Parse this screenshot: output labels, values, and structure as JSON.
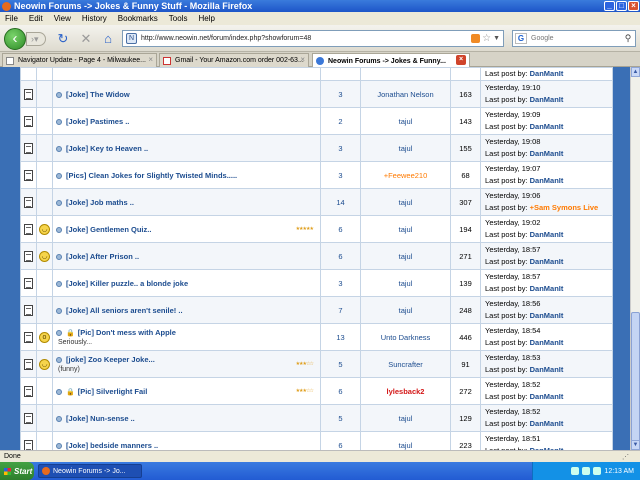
{
  "window": {
    "title": "Neowin Forums -> Jokes & Funny Stuff - Mozilla Firefox"
  },
  "menu": [
    "File",
    "Edit",
    "View",
    "History",
    "Bookmarks",
    "Tools",
    "Help"
  ],
  "nav": {
    "url": "http://www.neowin.net/forum/index.php?showforum=48",
    "search_placeholder": "Google"
  },
  "tabs": [
    {
      "label": "Navigator Update - Page 4 - Milwaukee..."
    },
    {
      "label": "Gmail - Your Amazon.com order 002-63..."
    },
    {
      "label": "Neowin Forums -> Jokes & Funny..."
    }
  ],
  "topics": [
    {
      "title": "[Joke] The Widow",
      "replies": "3",
      "starter": "Jonathan Nelson",
      "views": "163",
      "date": "Yesterday, 19:10",
      "lastpost_label": "Last post by:",
      "lastby": "DanManIt",
      "emoticon": "",
      "locked": false,
      "subtitle": "",
      "rating": ""
    },
    {
      "title": "[Joke] Pastimes ..",
      "replies": "2",
      "starter": "tajul",
      "views": "143",
      "date": "Yesterday, 19:09",
      "lastpost_label": "Last post by:",
      "lastby": "DanManIt",
      "emoticon": "",
      "locked": false,
      "subtitle": "",
      "rating": ""
    },
    {
      "title": "[Joke] Key to Heaven ..",
      "replies": "3",
      "starter": "tajul",
      "views": "155",
      "date": "Yesterday, 19:08",
      "lastpost_label": "Last post by:",
      "lastby": "DanManIt",
      "emoticon": "",
      "locked": false,
      "subtitle": "",
      "rating": ""
    },
    {
      "title": "[Pics] Clean Jokes for Slightly Twisted Minds.....",
      "replies": "3",
      "starter": "+Feewee210",
      "views": "68",
      "date": "Yesterday, 19:07",
      "lastpost_label": "Last post by:",
      "lastby": "DanManIt",
      "emoticon": "",
      "locked": false,
      "subtitle": "",
      "rating": ""
    },
    {
      "title": "[Joke] Job maths ..",
      "replies": "14",
      "starter": "tajul",
      "views": "307",
      "date": "Yesterday, 19:06",
      "lastpost_label": "Last post by:",
      "lastby": "+Sam Symons Live",
      "emoticon": "",
      "locked": false,
      "subtitle": "",
      "rating": ""
    },
    {
      "title": "[Joke] Gentlemen Quiz..",
      "replies": "6",
      "starter": "tajul",
      "views": "194",
      "date": "Yesterday, 19:02",
      "lastpost_label": "Last post by:",
      "lastby": "DanManIt",
      "emoticon": "grin",
      "locked": false,
      "subtitle": "",
      "rating": "★★★★★"
    },
    {
      "title": "[Joke] After Prison ..",
      "replies": "6",
      "starter": "tajul",
      "views": "271",
      "date": "Yesterday, 18:57",
      "lastpost_label": "Last post by:",
      "lastby": "DanManIt",
      "emoticon": "grin",
      "locked": false,
      "subtitle": "",
      "rating": ""
    },
    {
      "title": "[Joke] Killer puzzle.. a blonde joke",
      "replies": "3",
      "starter": "tajul",
      "views": "139",
      "date": "Yesterday, 18:57",
      "lastpost_label": "Last post by:",
      "lastby": "DanManIt",
      "emoticon": "",
      "locked": false,
      "subtitle": "",
      "rating": ""
    },
    {
      "title": "[Joke] All seniors aren't senile! ..",
      "replies": "7",
      "starter": "tajul",
      "views": "248",
      "date": "Yesterday, 18:56",
      "lastpost_label": "Last post by:",
      "lastby": "DanManIt",
      "emoticon": "",
      "locked": false,
      "subtitle": "",
      "rating": ""
    },
    {
      "title": "[Pic] Don't mess with Apple",
      "replies": "13",
      "starter": "Unto Darkness",
      "views": "446",
      "date": "Yesterday, 18:54",
      "lastpost_label": "Last post by:",
      "lastby": "DanManIt",
      "emoticon": "shock",
      "locked": true,
      "subtitle": "Seriously...",
      "rating": ""
    },
    {
      "title": "[joke] Zoo Keeper Joke...",
      "replies": "5",
      "starter": "Suncrafter",
      "views": "91",
      "date": "Yesterday, 18:53",
      "lastpost_label": "Last post by:",
      "lastby": "DanManIt",
      "emoticon": "grin",
      "locked": false,
      "subtitle": "(funny)",
      "rating": "★★★☆☆"
    },
    {
      "title": "[Pic] Silverlight Fail",
      "replies": "6",
      "starter": "lylesback2",
      "views": "272",
      "date": "Yesterday, 18:52",
      "lastpost_label": "Last post by:",
      "lastby": "DanManIt",
      "emoticon": "",
      "locked": true,
      "subtitle": "",
      "rating": "★★★☆☆"
    },
    {
      "title": "[Joke] Nun-sense ..",
      "replies": "5",
      "starter": "tajul",
      "views": "129",
      "date": "Yesterday, 18:52",
      "lastpost_label": "Last post by:",
      "lastby": "DanManIt",
      "emoticon": "",
      "locked": false,
      "subtitle": "",
      "rating": ""
    },
    {
      "title": "[Joke] bedside manners ..",
      "replies": "6",
      "starter": "tajul",
      "views": "223",
      "date": "Yesterday, 18:51",
      "lastpost_label": "Last post by:",
      "lastby": "DanManIt",
      "emoticon": "",
      "locked": false,
      "subtitle": "",
      "rating": ""
    }
  ],
  "top_partial": {
    "lastpost_label": "Last post by:",
    "lastby": "DanManIt"
  },
  "status": {
    "text": "Done"
  },
  "taskbar": {
    "start_label": "Start",
    "window_button": "Neowin Forums -> Jo...",
    "clock": "12:13 AM"
  },
  "colors": {
    "accent": "#3a6fb5",
    "link": "#1c4c8f",
    "orange_user": "#ff7a00",
    "red_user": "#d41818"
  }
}
